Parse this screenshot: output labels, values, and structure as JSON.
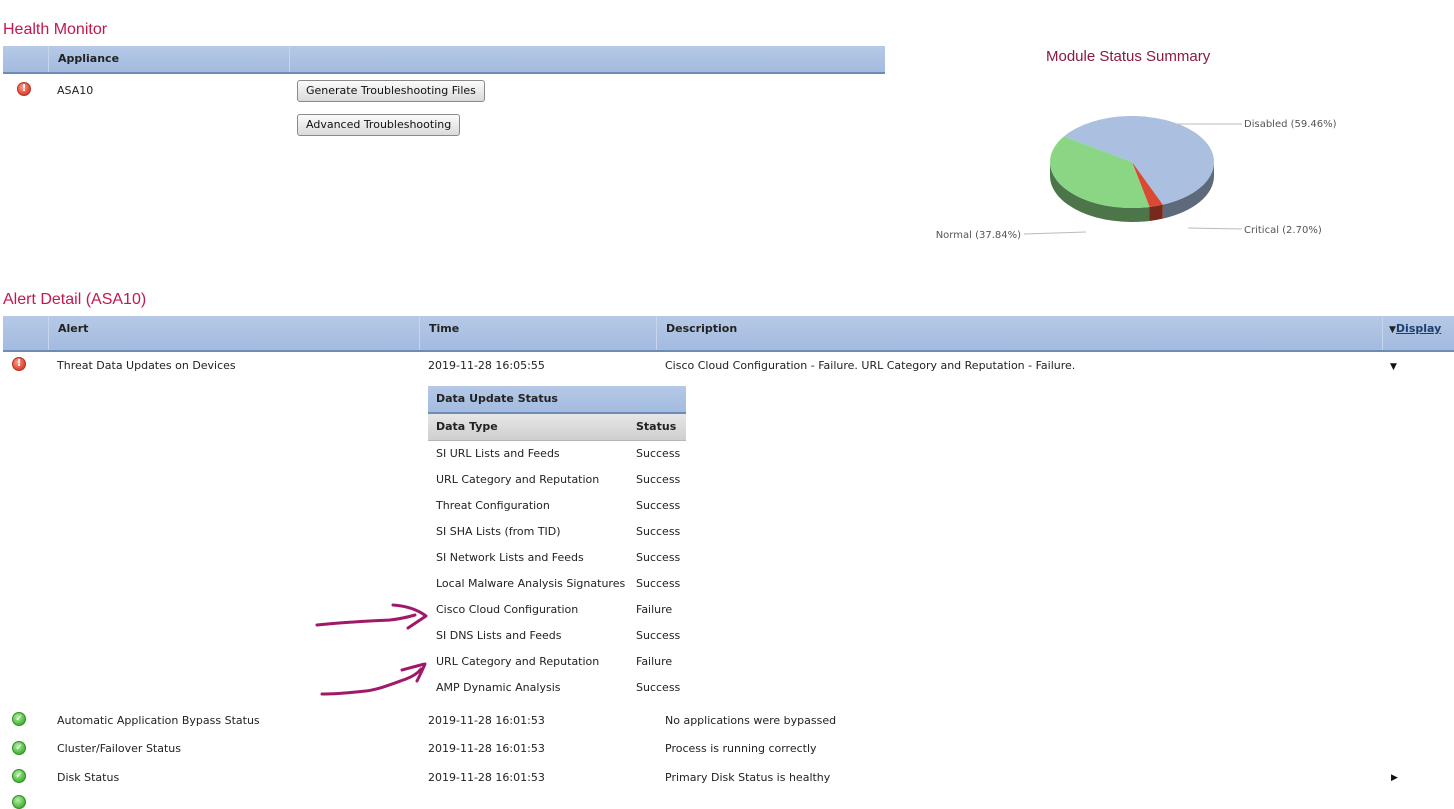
{
  "health_monitor": {
    "title": "Health Monitor",
    "columns": {
      "appliance": "Appliance"
    },
    "appliance": {
      "status_icon": "error-icon",
      "name": "ASA10",
      "buttons": {
        "generate": "Generate Troubleshooting Files",
        "advanced": "Advanced Troubleshooting"
      }
    }
  },
  "module_status_summary": {
    "title": "Module Status Summary",
    "chart_data": {
      "type": "pie",
      "title": "Module Status Summary",
      "slices": [
        {
          "name": "Disabled",
          "value": 59.46,
          "label": "Disabled (59.46%)",
          "color": "#abc0e0"
        },
        {
          "name": "Critical",
          "value": 2.7,
          "label": "Critical (2.70%)",
          "color": "#d84a33"
        },
        {
          "name": "Normal",
          "value": 37.84,
          "label": "Normal (37.84%)",
          "color": "#8ad684"
        }
      ]
    }
  },
  "alert_detail": {
    "title": "Alert Detail (ASA10)",
    "columns": {
      "alert": "Alert",
      "time": "Time",
      "description": "Description",
      "display": "Display"
    },
    "alerts": [
      {
        "status_icon": "error-icon",
        "alert": "Threat Data Updates on Devices",
        "time": "2019-11-28 16:05:55",
        "description": "Cisco Cloud Configuration - Failure. URL Category and Reputation - Failure.",
        "expanded": true
      },
      {
        "status_icon": "check-icon",
        "alert": "Automatic Application Bypass Status",
        "time": "2019-11-28 16:01:53",
        "description": "No applications were bypassed"
      },
      {
        "status_icon": "check-icon",
        "alert": "Cluster/Failover Status",
        "time": "2019-11-28 16:01:53",
        "description": "Process is running correctly"
      },
      {
        "status_icon": "check-icon",
        "alert": "Disk Status",
        "time": "2019-11-28 16:01:53",
        "description": "Primary Disk Status is healthy"
      }
    ],
    "data_update_status": {
      "title": "Data Update Status",
      "columns": {
        "data_type": "Data Type",
        "status": "Status"
      },
      "rows": [
        {
          "data_type": "SI URL Lists and Feeds",
          "status": "Success"
        },
        {
          "data_type": "URL Category and Reputation",
          "status": "Success"
        },
        {
          "data_type": "Threat Configuration",
          "status": "Success"
        },
        {
          "data_type": "SI SHA Lists (from TID)",
          "status": "Success"
        },
        {
          "data_type": "SI Network Lists and Feeds",
          "status": "Success"
        },
        {
          "data_type": "Local Malware Analysis Signatures",
          "status": "Success"
        },
        {
          "data_type": "Cisco Cloud Configuration",
          "status": "Failure"
        },
        {
          "data_type": "SI DNS Lists and Feeds",
          "status": "Success"
        },
        {
          "data_type": "URL Category and Reputation",
          "status": "Failure"
        },
        {
          "data_type": "AMP Dynamic Analysis",
          "status": "Success"
        }
      ]
    }
  },
  "annotations": {
    "color": "#a0186a",
    "arrows_point_to": [
      "Cisco Cloud Configuration",
      "URL Category and Reputation"
    ]
  }
}
